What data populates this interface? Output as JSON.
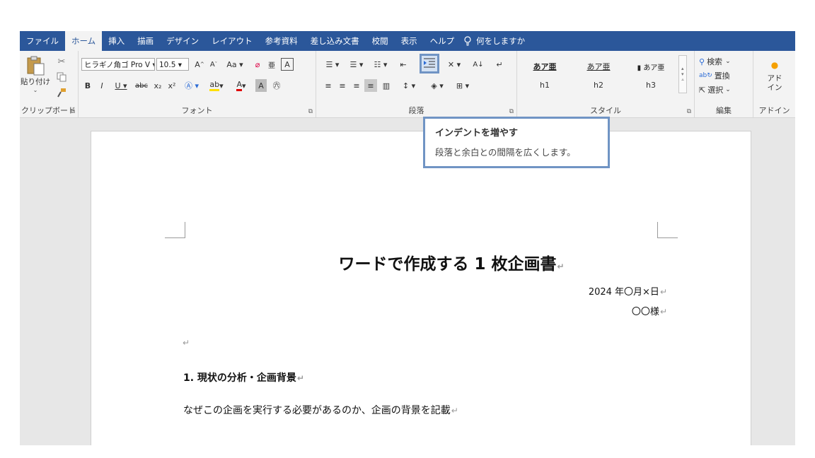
{
  "menu": {
    "tabs": [
      "ファイル",
      "ホーム",
      "挿入",
      "描画",
      "デザイン",
      "レイアウト",
      "参考資料",
      "差し込み文書",
      "校閲",
      "表示",
      "ヘルプ"
    ],
    "active_tab": "ホーム",
    "tell_me": "何をしますか"
  },
  "ribbon": {
    "clipboard": {
      "paste": "貼り付け",
      "label": "クリップボード"
    },
    "font": {
      "font_name": "ヒラギノ角ゴ Pro V",
      "font_size": "10.5",
      "label": "フォント"
    },
    "paragraph": {
      "label": "段落"
    },
    "styles": {
      "label": "スタイル",
      "items": [
        {
          "sample": "あア亜",
          "name": "h1"
        },
        {
          "sample": "あア亜",
          "name": "h2"
        },
        {
          "sample": "あア亜",
          "name": "h3"
        }
      ]
    },
    "editing": {
      "label": "編集",
      "find": "検索",
      "replace": "置換",
      "select": "選択"
    },
    "addins": {
      "button": "アド イン",
      "label": "アドイン"
    }
  },
  "tooltip": {
    "title": "インデントを増やす",
    "description": "段落と余白との間隔を広くします。"
  },
  "document": {
    "title": "ワードで作成する 1 枚企画書",
    "date": "2024 年〇月×日",
    "recipient": "〇〇様",
    "heading1": "1.  現状の分析・企画背景",
    "body1": "なぜこの企画を実行する必要があるのか、企画の背景を記載"
  },
  "colors": {
    "accent": "#2b579a",
    "highlight": "#7094c4"
  }
}
